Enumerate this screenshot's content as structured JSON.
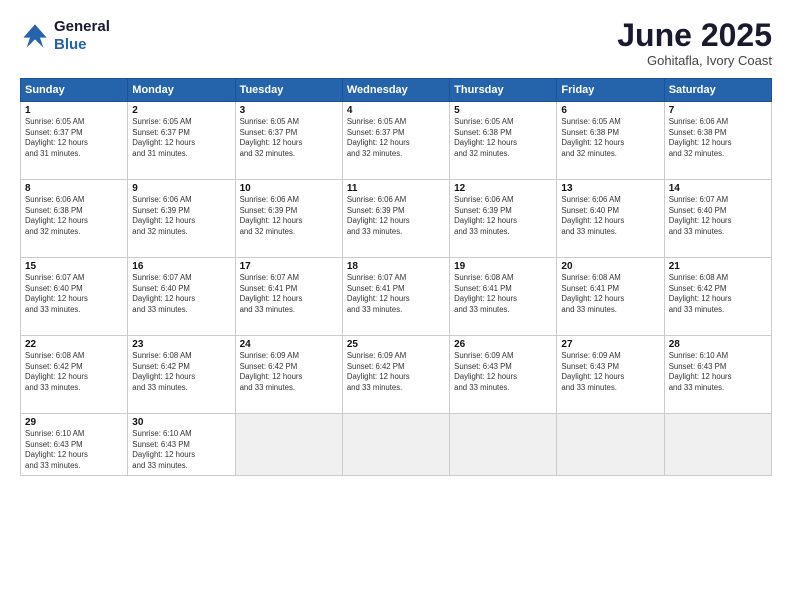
{
  "logo": {
    "line1": "General",
    "line2": "Blue"
  },
  "title": "June 2025",
  "subtitle": "Gohitafla, Ivory Coast",
  "days_header": [
    "Sunday",
    "Monday",
    "Tuesday",
    "Wednesday",
    "Thursday",
    "Friday",
    "Saturday"
  ],
  "weeks": [
    [
      {
        "day": "1",
        "info": "Sunrise: 6:05 AM\nSunset: 6:37 PM\nDaylight: 12 hours\nand 31 minutes."
      },
      {
        "day": "2",
        "info": "Sunrise: 6:05 AM\nSunset: 6:37 PM\nDaylight: 12 hours\nand 31 minutes."
      },
      {
        "day": "3",
        "info": "Sunrise: 6:05 AM\nSunset: 6:37 PM\nDaylight: 12 hours\nand 32 minutes."
      },
      {
        "day": "4",
        "info": "Sunrise: 6:05 AM\nSunset: 6:37 PM\nDaylight: 12 hours\nand 32 minutes."
      },
      {
        "day": "5",
        "info": "Sunrise: 6:05 AM\nSunset: 6:38 PM\nDaylight: 12 hours\nand 32 minutes."
      },
      {
        "day": "6",
        "info": "Sunrise: 6:05 AM\nSunset: 6:38 PM\nDaylight: 12 hours\nand 32 minutes."
      },
      {
        "day": "7",
        "info": "Sunrise: 6:06 AM\nSunset: 6:38 PM\nDaylight: 12 hours\nand 32 minutes."
      }
    ],
    [
      {
        "day": "8",
        "info": "Sunrise: 6:06 AM\nSunset: 6:38 PM\nDaylight: 12 hours\nand 32 minutes."
      },
      {
        "day": "9",
        "info": "Sunrise: 6:06 AM\nSunset: 6:39 PM\nDaylight: 12 hours\nand 32 minutes."
      },
      {
        "day": "10",
        "info": "Sunrise: 6:06 AM\nSunset: 6:39 PM\nDaylight: 12 hours\nand 32 minutes."
      },
      {
        "day": "11",
        "info": "Sunrise: 6:06 AM\nSunset: 6:39 PM\nDaylight: 12 hours\nand 33 minutes."
      },
      {
        "day": "12",
        "info": "Sunrise: 6:06 AM\nSunset: 6:39 PM\nDaylight: 12 hours\nand 33 minutes."
      },
      {
        "day": "13",
        "info": "Sunrise: 6:06 AM\nSunset: 6:40 PM\nDaylight: 12 hours\nand 33 minutes."
      },
      {
        "day": "14",
        "info": "Sunrise: 6:07 AM\nSunset: 6:40 PM\nDaylight: 12 hours\nand 33 minutes."
      }
    ],
    [
      {
        "day": "15",
        "info": "Sunrise: 6:07 AM\nSunset: 6:40 PM\nDaylight: 12 hours\nand 33 minutes."
      },
      {
        "day": "16",
        "info": "Sunrise: 6:07 AM\nSunset: 6:40 PM\nDaylight: 12 hours\nand 33 minutes."
      },
      {
        "day": "17",
        "info": "Sunrise: 6:07 AM\nSunset: 6:41 PM\nDaylight: 12 hours\nand 33 minutes."
      },
      {
        "day": "18",
        "info": "Sunrise: 6:07 AM\nSunset: 6:41 PM\nDaylight: 12 hours\nand 33 minutes."
      },
      {
        "day": "19",
        "info": "Sunrise: 6:08 AM\nSunset: 6:41 PM\nDaylight: 12 hours\nand 33 minutes."
      },
      {
        "day": "20",
        "info": "Sunrise: 6:08 AM\nSunset: 6:41 PM\nDaylight: 12 hours\nand 33 minutes."
      },
      {
        "day": "21",
        "info": "Sunrise: 6:08 AM\nSunset: 6:42 PM\nDaylight: 12 hours\nand 33 minutes."
      }
    ],
    [
      {
        "day": "22",
        "info": "Sunrise: 6:08 AM\nSunset: 6:42 PM\nDaylight: 12 hours\nand 33 minutes."
      },
      {
        "day": "23",
        "info": "Sunrise: 6:08 AM\nSunset: 6:42 PM\nDaylight: 12 hours\nand 33 minutes."
      },
      {
        "day": "24",
        "info": "Sunrise: 6:09 AM\nSunset: 6:42 PM\nDaylight: 12 hours\nand 33 minutes."
      },
      {
        "day": "25",
        "info": "Sunrise: 6:09 AM\nSunset: 6:42 PM\nDaylight: 12 hours\nand 33 minutes."
      },
      {
        "day": "26",
        "info": "Sunrise: 6:09 AM\nSunset: 6:43 PM\nDaylight: 12 hours\nand 33 minutes."
      },
      {
        "day": "27",
        "info": "Sunrise: 6:09 AM\nSunset: 6:43 PM\nDaylight: 12 hours\nand 33 minutes."
      },
      {
        "day": "28",
        "info": "Sunrise: 6:10 AM\nSunset: 6:43 PM\nDaylight: 12 hours\nand 33 minutes."
      }
    ],
    [
      {
        "day": "29",
        "info": "Sunrise: 6:10 AM\nSunset: 6:43 PM\nDaylight: 12 hours\nand 33 minutes."
      },
      {
        "day": "30",
        "info": "Sunrise: 6:10 AM\nSunset: 6:43 PM\nDaylight: 12 hours\nand 33 minutes."
      },
      {
        "day": "",
        "info": ""
      },
      {
        "day": "",
        "info": ""
      },
      {
        "day": "",
        "info": ""
      },
      {
        "day": "",
        "info": ""
      },
      {
        "day": "",
        "info": ""
      }
    ]
  ]
}
